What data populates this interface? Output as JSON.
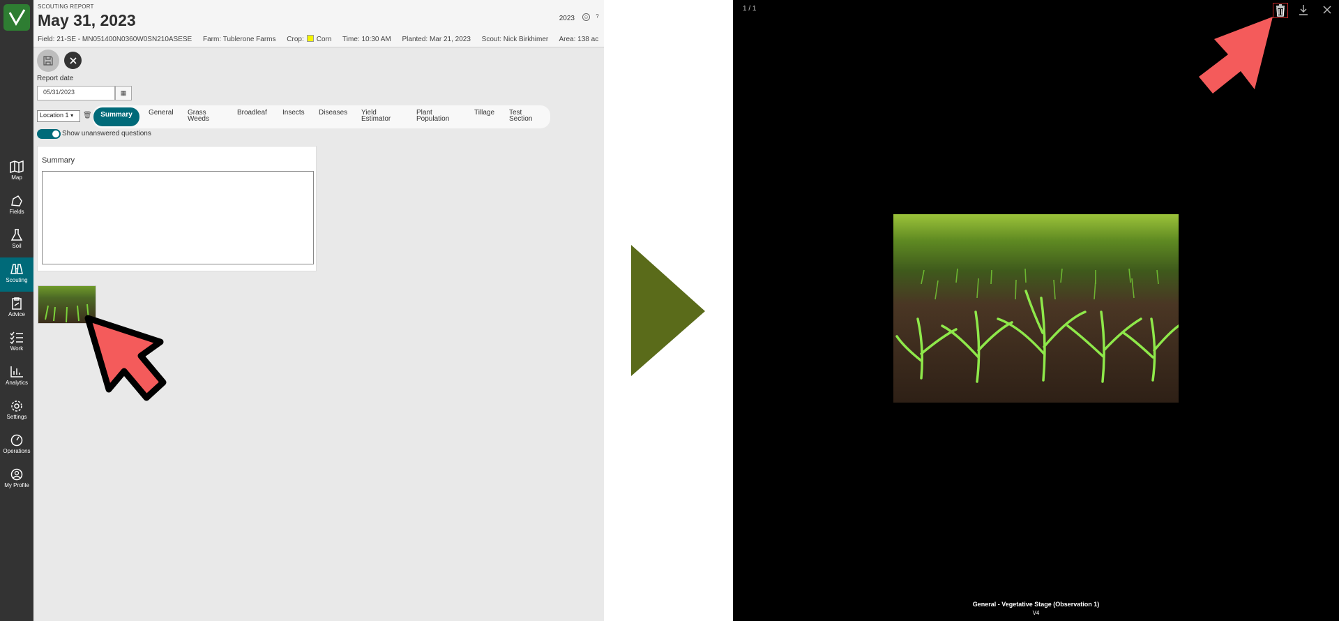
{
  "nav": {
    "items": [
      {
        "label": "Map",
        "icon": "map-icon"
      },
      {
        "label": "Fields",
        "icon": "fields-icon"
      },
      {
        "label": "Soil",
        "icon": "flask-icon"
      },
      {
        "label": "Scouting",
        "icon": "binoculars-icon",
        "active": true
      },
      {
        "label": "Advice",
        "icon": "clipboard-icon"
      },
      {
        "label": "Work",
        "icon": "checklist-icon"
      },
      {
        "label": "Analytics",
        "icon": "chart-icon"
      },
      {
        "label": "Settings",
        "icon": "gear-icon"
      },
      {
        "label": "Operations",
        "icon": "gauge-icon"
      },
      {
        "label": "My Profile",
        "icon": "user-icon"
      }
    ]
  },
  "header": {
    "kicker": "SCOUTING REPORT",
    "title": "May 31, 2023",
    "year": "2023",
    "field": "Field: 21-SE - MN051400N0360W0SN210ASESE",
    "farm": "Farm: Tublerone Farms",
    "crop_label": "Crop:",
    "crop": "Corn",
    "time": "Time: 10:30 AM",
    "planted": "Planted: Mar 21, 2023",
    "scout": "Scout: Nick Birkhimer",
    "area": "Area: 138 ac"
  },
  "form": {
    "report_date_label": "Report date",
    "report_date": "05/31/2023",
    "location": "Location 1",
    "show_unanswered": "Show unanswered questions",
    "summary_title": "Summary"
  },
  "tabs": [
    {
      "label": "Summary",
      "active": true
    },
    {
      "label": "General"
    },
    {
      "label": "Grass Weeds"
    },
    {
      "label": "Broadleaf"
    },
    {
      "label": "Insects"
    },
    {
      "label": "Diseases"
    },
    {
      "label": "Yield Estimator"
    },
    {
      "label": "Plant Population"
    },
    {
      "label": "Tillage"
    },
    {
      "label": "Test Section"
    }
  ],
  "viewer": {
    "counter": "1 / 1",
    "caption": "General - Vegetative Stage (Observation 1)",
    "subcaption": "V4"
  },
  "colors": {
    "accent": "#006a79",
    "rail": "#333333",
    "arrow": "#f45b5b",
    "divider_arrow": "#5a6b1a"
  }
}
